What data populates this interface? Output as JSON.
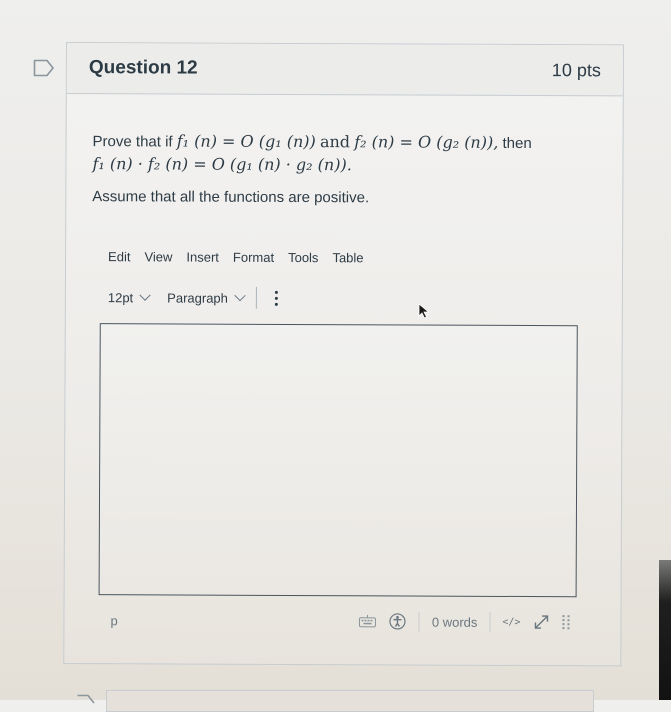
{
  "question": {
    "title": "Question 12",
    "points": "10 pts",
    "prompt": {
      "line1": {
        "lead": "Prove that if",
        "expr1": "f₁ (n) = O (g₁ (n))",
        "conj": "and",
        "expr2": "f₂ (n) = O (g₂ (n)),",
        "tail": "then"
      },
      "line2": {
        "expr": "f₁ (n) · f₂ (n) = O (g₁ (n) · g₂ (n))."
      }
    },
    "assumption": "Assume that all the functions are positive."
  },
  "editor": {
    "menubar": [
      "Edit",
      "View",
      "Insert",
      "Format",
      "Tools",
      "Table"
    ],
    "toolbar": {
      "font_size": "12pt",
      "block_format": "Paragraph",
      "more_icon": "more-vertical-icon"
    },
    "content": "",
    "statusbar": {
      "element_path": "p",
      "keyboard_icon": "keyboard-icon",
      "accessibility_icon": "accessibility-icon",
      "word_count": "0 words",
      "html_toggle": "</>",
      "fullscreen_icon": "expand-icon",
      "resize_icon": "resize-grip-icon"
    }
  },
  "colors": {
    "text": "#2d3b45",
    "muted": "#6b7780",
    "border": "#c7cdd1"
  }
}
